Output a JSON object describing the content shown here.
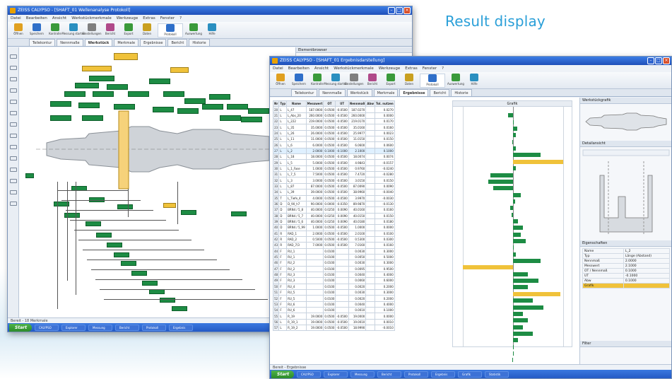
{
  "caption": "Result display",
  "colors": {
    "accent": "#2a9fd8",
    "ok_bar": "#1d8c44",
    "warn_bar": "#f0c23a",
    "titlebar": "#245ac4"
  },
  "left_window": {
    "title": "ZEISS CALYPSO - [SHAFT_01 Wellenanalyse Protokoll]",
    "menu": [
      "Datei",
      "Bearbeiten",
      "Ansicht",
      "Werkstückmerkmale",
      "Werkzeuge",
      "Extras",
      "Fenster",
      "?"
    ],
    "toolbar": [
      {
        "label": "Öffnen",
        "icon": "folder-open-icon"
      },
      {
        "label": "Speichern",
        "icon": "save-icon"
      },
      {
        "label": "Kontrolle",
        "icon": "check-icon"
      },
      {
        "label": "Messung starten",
        "icon": "play-icon"
      },
      {
        "label": "Einstellungen",
        "icon": "gear-icon"
      },
      {
        "label": "Bericht",
        "icon": "report-icon"
      },
      {
        "label": "Export",
        "icon": "export-icon"
      },
      {
        "label": "Daten",
        "icon": "data-icon"
      },
      {
        "label": "Protokoll",
        "icon": "protocol-icon"
      },
      {
        "label": "Auswertung",
        "icon": "evaluation-icon"
      },
      {
        "label": "Hilfe",
        "icon": "help-icon"
      }
    ],
    "tabs": [
      "Teilekontur",
      "Nennmaße",
      "Werkstück",
      "Merkmale",
      "Ergebnisse",
      "Bericht",
      "Historie"
    ],
    "active_tab": 2,
    "panel_title": "Elementbrowser",
    "status": "Bereit - 18 Merkmale",
    "taskbar": {
      "start": "Start",
      "tasks": [
        "CALYPSO",
        "Explorer",
        "Messung",
        "Bericht",
        "Protokoll",
        "Ergebnis"
      ]
    }
  },
  "right_window": {
    "title": "ZEISS CALYPSO - [SHAFT_01 Ergebnisdarstellung]",
    "menu": [
      "Datei",
      "Bearbeiten",
      "Ansicht",
      "Werkstückmerkmale",
      "Werkzeuge",
      "Extras",
      "Fenster",
      "?"
    ],
    "tabs": [
      "Teilekontur",
      "Nennmaße",
      "Werkstück",
      "Merkmale",
      "Ergebnisse",
      "Bericht",
      "Historie"
    ],
    "active_tab": 4,
    "columns": [
      "Nr",
      "Typ",
      "Name",
      "Messwert",
      "OT",
      "UT",
      "Nennmaß",
      "Abw",
      "Tol. nutzen"
    ],
    "graphic_header": "Grafik",
    "rows": [
      {
        "nr": "20",
        "typ": "L",
        "name": "L_47",
        "mw": "187.0000",
        "ot": "0.0500",
        "ut": "-0.0500",
        "nm": "187.0270",
        "tol": "0.0270",
        "dev": -0.1
      },
      {
        "nr": "21",
        "typ": "L",
        "name": "L_Abs_20",
        "mw": "260.0000",
        "ot": "0.0500",
        "ut": "-0.0500",
        "nm": "260.0000",
        "tol": "0.0000",
        "dev": 0.0
      },
      {
        "nr": "22",
        "typ": "L",
        "name": "L_222",
        "mw": "219.0000",
        "ot": "0.0500",
        "ut": "-0.0500",
        "nm": "219.0170",
        "tol": "0.0170",
        "dev": 0.08
      },
      {
        "nr": "23",
        "typ": "L",
        "name": "L_35",
        "mw": "35.0000",
        "ot": "0.0500",
        "ut": "-0.0500",
        "nm": "35.0160",
        "tol": "0.0160",
        "dev": 0.06
      },
      {
        "nr": "24",
        "typ": "L",
        "name": "L_26",
        "mw": "26.0000",
        "ot": "0.0500",
        "ut": "-0.0500",
        "nm": "25.9977",
        "tol": "0.0023",
        "dev": -0.02
      },
      {
        "nr": "25",
        "typ": "L",
        "name": "L_11",
        "mw": "11.0000",
        "ot": "0.0500",
        "ut": "-0.0500",
        "nm": "11.0150",
        "tol": "0.0150",
        "dev": 0.05
      },
      {
        "nr": "26",
        "typ": "L",
        "name": "L_6",
        "mw": "6.0000",
        "ot": "0.0500",
        "ut": "-0.0500",
        "nm": "6.0600",
        "tol": "0.0600",
        "dev": 0.55
      },
      {
        "nr": "27",
        "typ": "L",
        "name": "L_2",
        "mw": "2.0000",
        "ot": "0.1000",
        "ut": "-0.1000",
        "nm": "2.1000",
        "tol": "0.1000",
        "dev": 1.0,
        "warn": true,
        "sel": true
      },
      {
        "nr": "28",
        "typ": "L",
        "name": "L_18",
        "mw": "18.0000",
        "ot": "0.0500",
        "ut": "-0.0500",
        "nm": "18.0074",
        "tol": "0.0074",
        "dev": 0.06
      },
      {
        "nr": "29",
        "typ": "L",
        "name": "L_5",
        "mw": "5.0000",
        "ot": "0.0500",
        "ut": "-0.0500",
        "nm": "4.9843",
        "tol": "-0.0157",
        "dev": -0.45
      },
      {
        "nr": "30",
        "typ": "L",
        "name": "L_1_Fase",
        "mw": "1.0000",
        "ot": "0.0500",
        "ut": "-0.0500",
        "nm": "0.9760",
        "tol": "-0.0240",
        "dev": -0.5
      },
      {
        "nr": "31",
        "typ": "L",
        "name": "L_7_5",
        "mw": "7.5000",
        "ot": "0.0500",
        "ut": "-0.0500",
        "nm": "7.4720",
        "tol": "-0.0280",
        "dev": -0.4
      },
      {
        "nr": "32",
        "typ": "L",
        "name": "L_3",
        "mw": "3.0000",
        "ot": "0.0500",
        "ut": "-0.0500",
        "nm": "3.0150",
        "tol": "0.0150",
        "dev": 0.15
      },
      {
        "nr": "33",
        "typ": "L",
        "name": "L_87",
        "mw": "87.0000",
        "ot": "0.0500",
        "ut": "-0.0500",
        "nm": "87.0090",
        "tol": "0.0090",
        "dev": 0.04
      },
      {
        "nr": "34",
        "typ": "L",
        "name": "L_39",
        "mw": "39.0000",
        "ot": "0.0500",
        "ut": "-0.0500",
        "nm": "38.9960",
        "tol": "-0.0040",
        "dev": -0.05
      },
      {
        "nr": "35",
        "typ": "T",
        "name": "L_Tiefe_4",
        "mw": "4.0000",
        "ot": "0.0500",
        "ut": "-0.0500",
        "nm": "3.9970",
        "tol": "-0.0030",
        "dev": -0.03
      },
      {
        "nr": "36",
        "typ": "D",
        "name": "D_90_h7",
        "mw": "90.0000",
        "ot": "0.0000",
        "ut": "-0.0350",
        "nm": "89.9870",
        "tol": "-0.0130",
        "dev": 0.1
      },
      {
        "nr": "37",
        "typ": "D",
        "name": "BRN4 / 5_8",
        "mw": "40.0000",
        "ot": "0.0250",
        "ut": "0.0090",
        "nm": "40.0160",
        "tol": "0.0160",
        "dev": 0.2
      },
      {
        "nr": "38",
        "typ": "D",
        "name": "BRN4 / 5_7",
        "mw": "40.0000",
        "ot": "0.0250",
        "ut": "0.0090",
        "nm": "40.0150",
        "tol": "0.0150",
        "dev": 0.15
      },
      {
        "nr": "39",
        "typ": "D",
        "name": "BRN4 / 5_6",
        "mw": "40.0000",
        "ot": "0.0250",
        "ut": "0.0090",
        "nm": "40.0180",
        "tol": "0.0180",
        "dev": 0.25
      },
      {
        "nr": "40",
        "typ": "D",
        "name": "BRN4 / 5_99",
        "mw": "1.0000",
        "ot": "0.0500",
        "ut": "-0.0500",
        "nm": "1.0000",
        "tol": "0.0000",
        "dev": 0.0
      },
      {
        "nr": "41",
        "typ": "R",
        "name": "RAD_1",
        "mw": "2.0000",
        "ot": "0.0500",
        "ut": "-0.0500",
        "nm": "2.0100",
        "tol": "0.0100",
        "dev": 0.06
      },
      {
        "nr": "42",
        "typ": "R",
        "name": "RAD_2",
        "mw": "0.5000",
        "ot": "0.0500",
        "ut": "-0.0500",
        "nm": "0.5300",
        "tol": "0.0300",
        "dev": 0.55
      },
      {
        "nr": "43",
        "typ": "R",
        "name": "RAD_7/3",
        "mw": "7.0000",
        "ot": "0.0500",
        "ut": "-0.0500",
        "nm": "7.0160",
        "tol": "0.0160",
        "dev": -1.0,
        "warn": true
      },
      {
        "nr": "44",
        "typ": "F",
        "name": "RU_1",
        "mw": "",
        "ot": "0.0100",
        "ut": "",
        "nm": "0.0030",
        "tol": "0.3000",
        "dev": 0.3
      },
      {
        "nr": "45",
        "typ": "F",
        "name": "RU_1",
        "mw": "",
        "ot": "0.0100",
        "ut": "",
        "nm": "0.0050",
        "tol": "0.5000",
        "dev": 0.5
      },
      {
        "nr": "46",
        "typ": "F",
        "name": "RU_2",
        "mw": "",
        "ot": "0.0100",
        "ut": "",
        "nm": "0.0030",
        "tol": "0.3000",
        "dev": 0.3
      },
      {
        "nr": "47",
        "typ": "F",
        "name": "RU_2",
        "mw": "",
        "ot": "0.0100",
        "ut": "",
        "nm": "0.0095",
        "tol": "0.9500",
        "dev": 0.95,
        "warn": true
      },
      {
        "nr": "48",
        "typ": "F",
        "name": "RU_3",
        "mw": "",
        "ot": "0.0100",
        "ut": "",
        "nm": "0.0040",
        "tol": "0.4000",
        "dev": 0.4
      },
      {
        "nr": "49",
        "typ": "F",
        "name": "RU_3",
        "mw": "",
        "ot": "0.0100",
        "ut": "",
        "nm": "0.0060",
        "tol": "0.6000",
        "dev": 0.6
      },
      {
        "nr": "50",
        "typ": "F",
        "name": "RU_4",
        "mw": "",
        "ot": "0.0100",
        "ut": "",
        "nm": "0.0020",
        "tol": "0.2000",
        "dev": 0.2
      },
      {
        "nr": "51",
        "typ": "F",
        "name": "RU_5",
        "mw": "",
        "ot": "0.0100",
        "ut": "",
        "nm": "0.0030",
        "tol": "0.3000",
        "dev": 0.3
      },
      {
        "nr": "52",
        "typ": "F",
        "name": "RU_5",
        "mw": "",
        "ot": "0.0100",
        "ut": "",
        "nm": "0.0020",
        "tol": "0.2000",
        "dev": 0.2
      },
      {
        "nr": "53",
        "typ": "F",
        "name": "RU_6",
        "mw": "",
        "ot": "0.0100",
        "ut": "",
        "nm": "0.0040",
        "tol": "0.4000",
        "dev": 0.4
      },
      {
        "nr": "54",
        "typ": "F",
        "name": "RU_6",
        "mw": "",
        "ot": "0.0100",
        "ut": "",
        "nm": "0.0010",
        "tol": "0.1000",
        "dev": 0.1
      },
      {
        "nr": "55",
        "typ": "L",
        "name": "R_19",
        "mw": "19.0000",
        "ot": "0.0500",
        "ut": "-0.0500",
        "nm": "19.0000",
        "tol": "0.0000",
        "dev": 0.0
      },
      {
        "nr": "56",
        "typ": "L",
        "name": "R_19_1",
        "mw": "19.0000",
        "ot": "0.0500",
        "ut": "-0.0500",
        "nm": "19.0010",
        "tol": "0.0010",
        "dev": 0.01
      },
      {
        "nr": "57",
        "typ": "L",
        "name": "R_19_2",
        "mw": "19.0000",
        "ot": "0.0500",
        "ut": "-0.0500",
        "nm": "18.9990",
        "tol": "-0.0010",
        "dev": -0.01
      }
    ],
    "side": {
      "preview_title": "Werkstückgrafik",
      "detail_title": "Detailansicht",
      "props_title": "Eigenschaften",
      "props": [
        {
          "k": "Name",
          "v": "L_2"
        },
        {
          "k": "Typ",
          "v": "Länge (Abstand)"
        },
        {
          "k": "Nennmaß",
          "v": "2.0000"
        },
        {
          "k": "Messwert",
          "v": "2.1000"
        },
        {
          "k": "OT / Nennmaß",
          "v": "0.1000"
        },
        {
          "k": "UT",
          "v": "-0.1000"
        },
        {
          "k": "Abw",
          "v": "0.1000"
        },
        {
          "k": "Grafik",
          "v": ""
        }
      ],
      "footer": "Filter"
    },
    "status": "Bereit - Ergebnisse",
    "taskbar": {
      "start": "Start",
      "tasks": [
        "CALYPSO",
        "Explorer",
        "Messung",
        "Bericht",
        "Protokoll",
        "Ergebnis",
        "Grafik",
        "Statistik"
      ]
    }
  }
}
